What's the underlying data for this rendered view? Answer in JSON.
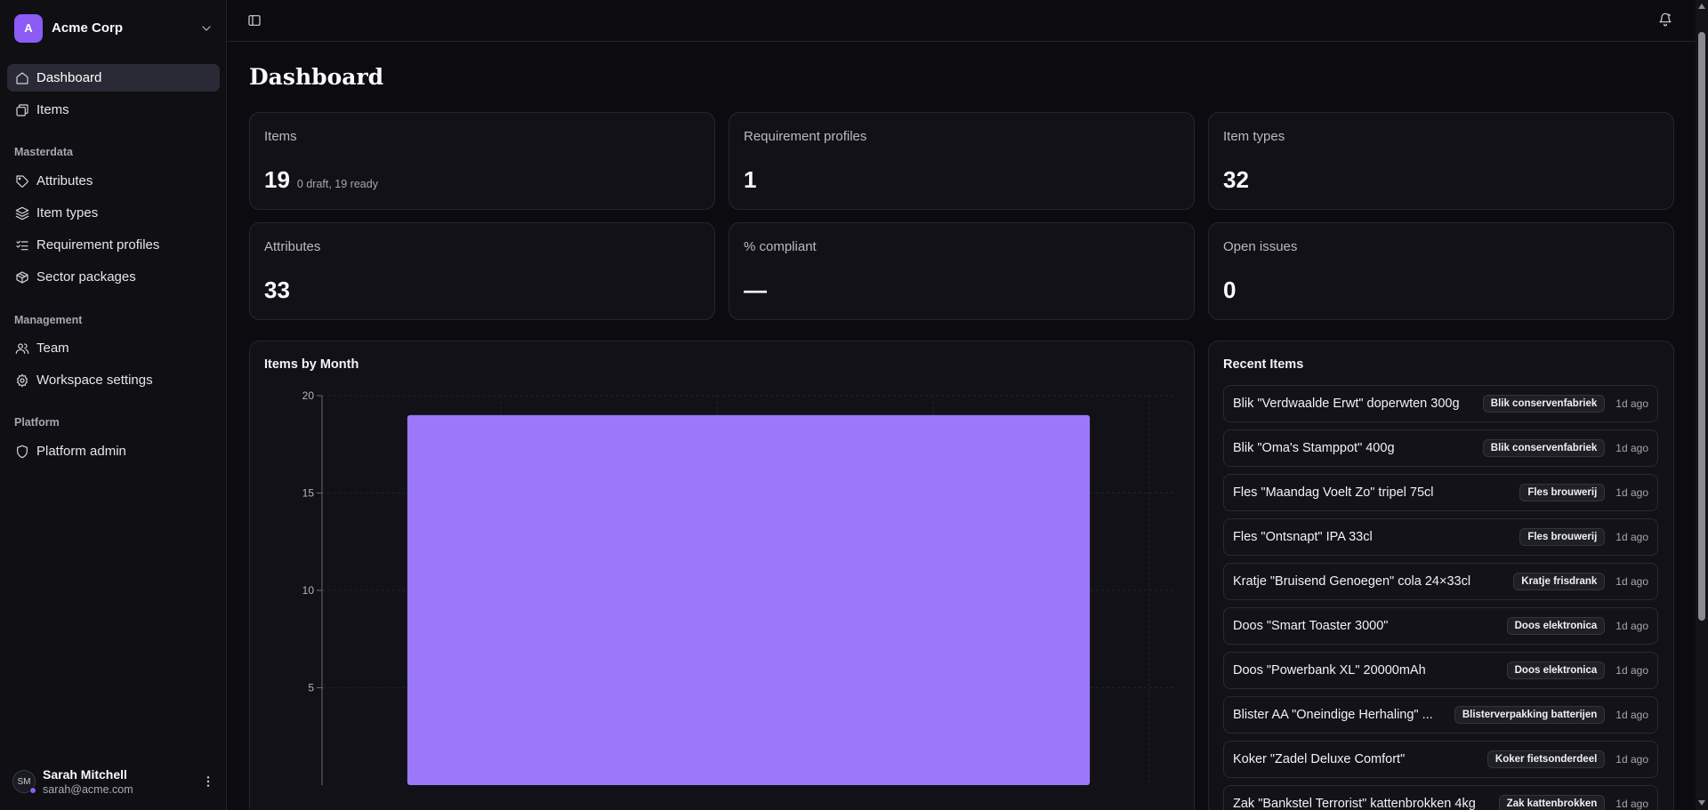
{
  "org": {
    "initial": "A",
    "name": "Acme Corp"
  },
  "nav": {
    "main": [
      {
        "label": "Dashboard",
        "icon": "home-icon"
      },
      {
        "label": "Items",
        "icon": "items-icon"
      }
    ],
    "masterdata_title": "Masterdata",
    "masterdata": [
      {
        "label": "Attributes",
        "icon": "tag-icon"
      },
      {
        "label": "Item types",
        "icon": "layers-icon"
      },
      {
        "label": "Requirement profiles",
        "icon": "list-checks-icon"
      },
      {
        "label": "Sector packages",
        "icon": "package-icon"
      }
    ],
    "management_title": "Management",
    "management": [
      {
        "label": "Team",
        "icon": "users-icon"
      },
      {
        "label": "Workspace settings",
        "icon": "gear-icon"
      }
    ],
    "platform_title": "Platform",
    "platform": [
      {
        "label": "Platform admin",
        "icon": "shield-icon"
      }
    ]
  },
  "user": {
    "initials": "SM",
    "name": "Sarah Mitchell",
    "email": "sarah@acme.com"
  },
  "page": {
    "title": "Dashboard"
  },
  "stats": [
    {
      "label": "Items",
      "value": "19",
      "sub": "0 draft, 19 ready"
    },
    {
      "label": "Requirement profiles",
      "value": "1",
      "sub": ""
    },
    {
      "label": "Item types",
      "value": "32",
      "sub": ""
    },
    {
      "label": "Attributes",
      "value": "33",
      "sub": ""
    },
    {
      "label": "% compliant",
      "value": "—",
      "sub": ""
    },
    {
      "label": "Open issues",
      "value": "0",
      "sub": ""
    }
  ],
  "chart_data": {
    "type": "bar",
    "title": "Items by Month",
    "categories": [
      ""
    ],
    "values": [
      19
    ],
    "ylim": [
      0,
      20
    ],
    "yticks": [
      5,
      10,
      15,
      20
    ],
    "grid": true,
    "bar_color": "#9b78f7"
  },
  "recent": {
    "title": "Recent Items",
    "items": [
      {
        "name": "Blik \"Verdwaalde Erwt\" doperwten 300g",
        "badge": "Blik conservenfabriek",
        "time": "1d ago"
      },
      {
        "name": "Blik \"Oma's Stamppot\" 400g",
        "badge": "Blik conservenfabriek",
        "time": "1d ago"
      },
      {
        "name": "Fles \"Maandag Voelt Zo\" tripel 75cl",
        "badge": "Fles brouwerij",
        "time": "1d ago"
      },
      {
        "name": "Fles \"Ontsnapt\" IPA 33cl",
        "badge": "Fles brouwerij",
        "time": "1d ago"
      },
      {
        "name": "Kratje \"Bruisend Genoegen\" cola 24×33cl",
        "badge": "Kratje frisdrank",
        "time": "1d ago"
      },
      {
        "name": "Doos \"Smart Toaster 3000\"",
        "badge": "Doos elektronica",
        "time": "1d ago"
      },
      {
        "name": "Doos \"Powerbank XL\" 20000mAh",
        "badge": "Doos elektronica",
        "time": "1d ago"
      },
      {
        "name": "Blister AA \"Oneindige Herhaling\" ...",
        "badge": "Blisterverpakking batterijen",
        "time": "1d ago"
      },
      {
        "name": "Koker \"Zadel Deluxe Comfort\"",
        "badge": "Koker fietsonderdeel",
        "time": "1d ago"
      },
      {
        "name": "Zak \"Bankstel Terrorist\" kattenbrokken 4kg",
        "badge": "Zak kattenbrokken",
        "time": "1d ago"
      }
    ]
  }
}
